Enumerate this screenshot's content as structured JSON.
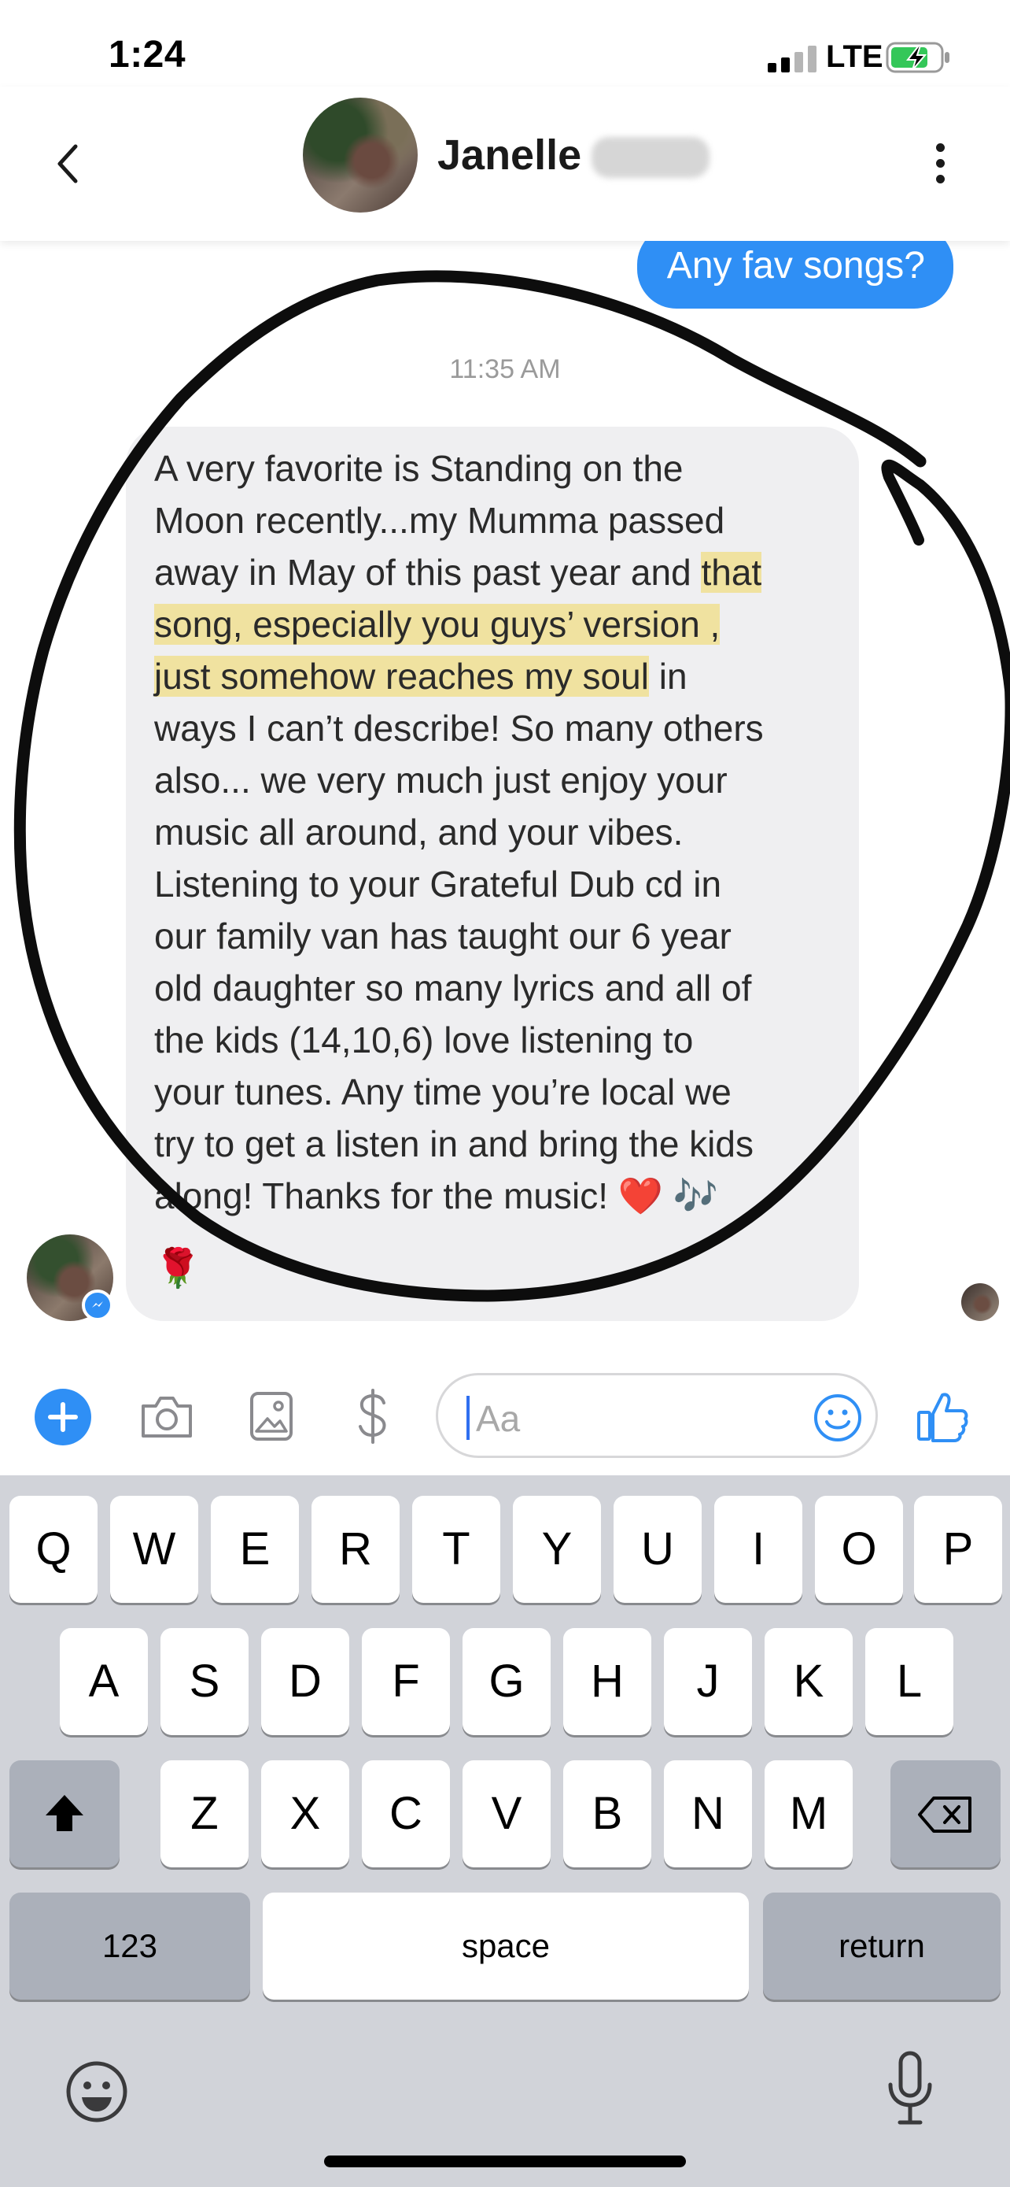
{
  "status_bar": {
    "time": "1:24",
    "network": "LTE"
  },
  "header": {
    "contact_name": "Janelle"
  },
  "conversation": {
    "sent_message": "Any fav songs?",
    "timestamp": "11:35 AM",
    "received_message": {
      "before_highlight": "A very favorite is Standing on the\nMoon recently...my Mumma passed\naway in May of this past year and ",
      "highlight": "that\nsong, especially you guys’ version ,\njust somehow reaches my soul",
      "after_highlight": " in\nways I can’t describe! So many others\nalso... we very much just enjoy your\nmusic all around, and your vibes.\nListening to your Grateful Dub cd in\nour family van has taught our 6 year\nold daughter so many lyrics and all of\nthe kids (14,10,6) love listening to\nyour tunes. Any time you’re local we\ntry to get a listen in and bring the kids\nalong! Thanks for the music! ❤️ 🎶",
      "trailing_emoji": "🌹"
    },
    "annotation": "hand-drawn black circle around message",
    "highlight_color": "#f0e2a0"
  },
  "composer": {
    "placeholder": "Aa",
    "icons": [
      "plus-icon",
      "camera-icon",
      "image-icon",
      "dollar-icon",
      "emoji-icon",
      "thumbs-up-icon"
    ]
  },
  "keyboard": {
    "row1": [
      "Q",
      "W",
      "E",
      "R",
      "T",
      "Y",
      "U",
      "I",
      "O",
      "P"
    ],
    "row2": [
      "A",
      "S",
      "D",
      "F",
      "G",
      "H",
      "J",
      "K",
      "L"
    ],
    "row3": [
      "Z",
      "X",
      "C",
      "V",
      "B",
      "N",
      "M"
    ],
    "numbers_label": "123",
    "space_label": "space",
    "return_label": "return"
  },
  "colors": {
    "accent": "#2f8ff5",
    "bubble_received": "#efeff1",
    "keyboard_bg": "#d1d3d9"
  }
}
